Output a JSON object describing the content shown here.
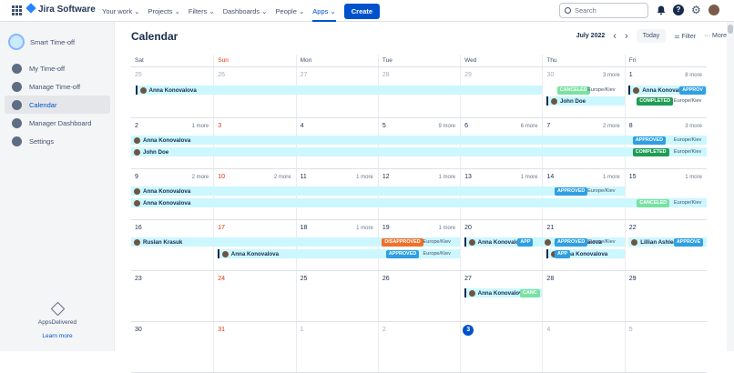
{
  "topnav": {
    "product": "Jira Software",
    "items": [
      "Your work ⌄",
      "Projects ⌄",
      "Filters ⌄",
      "Dashboards ⌄",
      "People ⌄",
      "Apps ⌄"
    ],
    "create": "Create",
    "search_placeholder": "Search"
  },
  "sidebar": {
    "app_name": "Smart Time-off",
    "items": [
      "My Time-off",
      "Manage Time-off",
      "Calendar",
      "Manager Dashboard",
      "Settings"
    ],
    "vendor": "AppsDelivered",
    "learn_more": "Learn more"
  },
  "main": {
    "title": "Calendar",
    "month": "July 2022",
    "today": "Today",
    "filter": "Filter",
    "more": "More",
    "weekdays": [
      "Sat",
      "Sun",
      "Mon",
      "Tue",
      "Wed",
      "Thu",
      "Fri"
    ]
  },
  "weeks": [
    {
      "days": [
        "25",
        "26",
        "27",
        "28",
        "29",
        "30",
        "1"
      ],
      "more": [
        "",
        "",
        "",
        "",
        "",
        "3 more",
        "8 more"
      ]
    },
    {
      "days": [
        "2",
        "3",
        "4",
        "5",
        "6",
        "7",
        "8"
      ],
      "more": [
        "1 more",
        "",
        "",
        "9 more",
        "6 more",
        "2 more",
        "3 more"
      ]
    },
    {
      "days": [
        "9",
        "10",
        "11",
        "12",
        "13",
        "14",
        "15"
      ],
      "more": [
        "2 more",
        "2 more",
        "1 more",
        "1 more",
        "1 more",
        "1 more",
        "1 more"
      ]
    },
    {
      "days": [
        "16",
        "17",
        "18",
        "19",
        "20",
        "21",
        "22"
      ],
      "more": [
        "",
        "",
        "1 more",
        "1 more",
        "",
        "",
        ""
      ]
    },
    {
      "days": [
        "23",
        "24",
        "25",
        "26",
        "27",
        "28",
        "29"
      ],
      "more": [
        "",
        "",
        "",
        "",
        "",
        "",
        ""
      ]
    },
    {
      "days": [
        "30",
        "31",
        "1",
        "2",
        "3",
        "4",
        "5"
      ],
      "more": [
        "",
        "",
        "",
        "",
        "",
        "",
        ""
      ]
    }
  ],
  "events": {
    "w0": [
      {
        "name": "Anna Konovalova"
      },
      {
        "name": "John Doe"
      },
      {
        "name": "Anna Konovalova",
        "badge": "APPROV"
      },
      {
        "badge": "CANCELED",
        "loc": "Europe/Kiev"
      },
      {
        "badge": "COMPLETED",
        "loc": "Europe/Kiev"
      }
    ],
    "w1": [
      {
        "name": "Anna Konovalova",
        "badge": "APPROVED",
        "loc": "Europe/Kiev"
      },
      {
        "name": "John Doe",
        "badge": "COMPLETED",
        "loc": "Europe/Kiev"
      }
    ],
    "w2": [
      {
        "name": "Anna Konovalova",
        "badge": "APPROVED",
        "loc": "Europe/Kiev"
      },
      {
        "name": "Anna Konovalova",
        "badge": "CANCELED",
        "loc": "Europe/Kiev"
      }
    ],
    "w3": [
      {
        "name": "Ruslan Krasuk",
        "badge": "DISAPPROVED",
        "loc": "Europe/Kiev"
      },
      {
        "name": "Anna Konovalova",
        "badge": "APPROVED",
        "loc": "Europe/Kiev"
      },
      {
        "name": "Anna Konovalova",
        "badge": "APPROVED",
        "loc": "Europe/Kiev"
      },
      {
        "name": "Anna Konovalova",
        "badge": "APP"
      },
      {
        "name": "Anna Konovalova",
        "badge": "APP"
      },
      {
        "name": "Lillian Ashlea",
        "badge": "APPROVE"
      }
    ],
    "w4": [
      {
        "name": "Anna Konovalova",
        "badge": "CANC"
      }
    ]
  }
}
